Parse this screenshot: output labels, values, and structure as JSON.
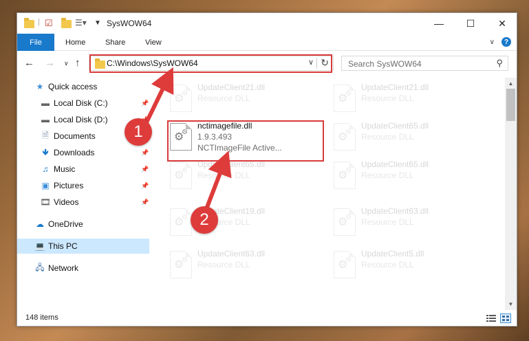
{
  "window": {
    "title": "SysWOW64",
    "minimize": "—",
    "maximize": "☐",
    "close": "✕"
  },
  "ribbon": {
    "tabs": [
      "File",
      "Home",
      "Share",
      "View"
    ]
  },
  "address": {
    "path": "C:\\Windows\\SysWOW64"
  },
  "search": {
    "placeholder": "Search SysWOW64"
  },
  "sidebar": {
    "items": [
      {
        "label": "Quick access",
        "icon": "star-icon",
        "pinned": false
      },
      {
        "label": "Local Disk (C:)",
        "icon": "drive-icon",
        "pinned": true
      },
      {
        "label": "Local Disk (D:)",
        "icon": "drive-icon",
        "pinned": true
      },
      {
        "label": "Documents",
        "icon": "documents-icon",
        "pinned": true
      },
      {
        "label": "Downloads",
        "icon": "download-icon",
        "pinned": true
      },
      {
        "label": "Music",
        "icon": "music-icon",
        "pinned": true
      },
      {
        "label": "Pictures",
        "icon": "pictures-icon",
        "pinned": true
      },
      {
        "label": "Videos",
        "icon": "videos-icon",
        "pinned": true
      },
      {
        "label": "OneDrive",
        "icon": "cloud-icon",
        "pinned": false
      },
      {
        "label": "This PC",
        "icon": "computer-icon",
        "pinned": false,
        "selected": true
      },
      {
        "label": "Network",
        "icon": "network-icon",
        "pinned": false
      }
    ]
  },
  "files": {
    "left": [
      {
        "name": "UpdateClient21.dll",
        "line1": "Resource DLL",
        "line2": ""
      },
      {
        "name": "nctimagefile.dll",
        "line1": "1.9.3.493",
        "line2": "NCTImageFile Active...",
        "highlighted": true
      },
      {
        "name": "UpdateClient65.dll",
        "line1": "Resource DLL",
        "line2": ""
      },
      {
        "name": "UpdateClient19.dll",
        "line1": "Resource DLL",
        "line2": ""
      },
      {
        "name": "UpdateClient63.dll",
        "line1": "Resource DLL",
        "line2": ""
      }
    ],
    "right": [
      {
        "name": "UpdateClient21.dll",
        "line1": "Resource DLL",
        "line2": ""
      },
      {
        "name": "UpdateClient65.dll",
        "line1": "Resource DLL",
        "line2": ""
      },
      {
        "name": "UpdateClient65.dll",
        "line1": "Resource DLL",
        "line2": ""
      },
      {
        "name": "UpdateClient63.dll",
        "line1": "Resource DLL",
        "line2": ""
      },
      {
        "name": "UpdateClient5.dll",
        "line1": "Resource DLL",
        "line2": ""
      }
    ]
  },
  "status": {
    "item_count": "148 items"
  },
  "callouts": [
    "1",
    "2"
  ],
  "colors": {
    "accent": "#1979ca",
    "highlight": "#d93a3a",
    "callout": "#de3b3b",
    "selected": "#cce8ff"
  }
}
